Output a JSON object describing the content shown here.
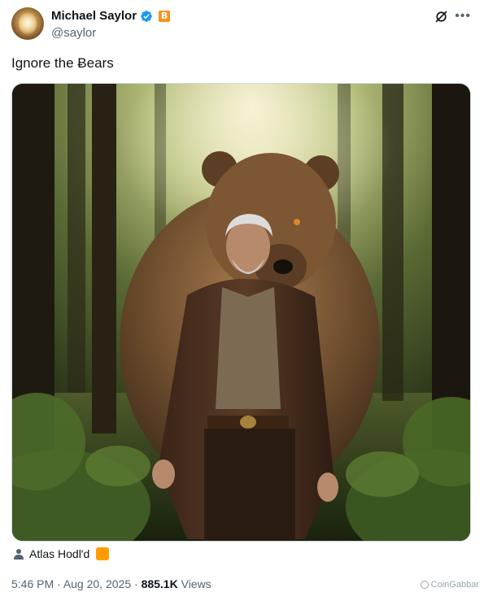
{
  "author": {
    "display_name": "Michael Saylor",
    "handle": "@saylor",
    "badge_symbol": "B"
  },
  "tweet": {
    "text": "Ignore the Ƀears",
    "image_alt": "A grey-haired man in a brown coat walking through a sunlit forest with a giant brown bear looming behind him"
  },
  "media_credit": {
    "name": "Atlas Hodl'd"
  },
  "meta": {
    "time": "5:46 PM",
    "date": "Aug 20, 2025",
    "views_count": "885.1K",
    "views_label": "Views"
  },
  "watermark": {
    "text": "CoinGabbar"
  },
  "colors": {
    "verified": "#1d9bf0",
    "bitcoin_orange": "#f7931a",
    "secondary_text": "#536471",
    "primary_text": "#0f1419"
  }
}
